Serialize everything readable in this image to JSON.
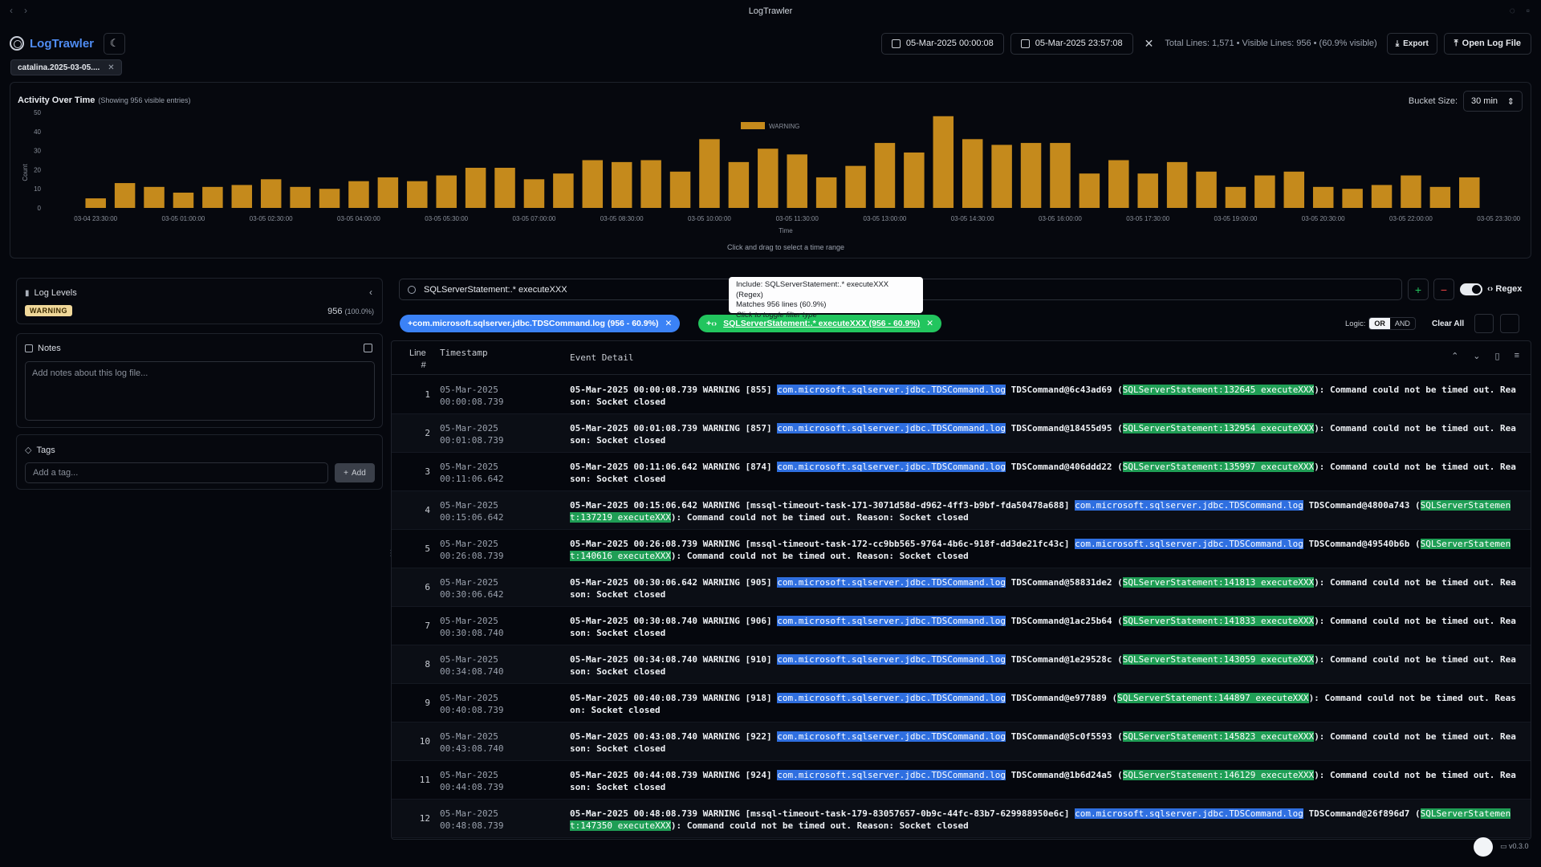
{
  "window": {
    "title": "LogTrawler"
  },
  "header": {
    "app_name": "LogTrawler",
    "start_time": "05-Mar-2025 00:00:08",
    "end_time": "05-Mar-2025 23:57:08",
    "stats": "Total Lines: 1,571  •  Visible Lines: 956  •  (60.9% visible)",
    "export_label": "Export",
    "open_label": "Open Log File"
  },
  "file_tab": {
    "label": "catalina.2025-03-05...."
  },
  "chart_panel": {
    "title": "Activity Over Time",
    "subtitle": "(Showing 956 visible entries)",
    "bucket_label": "Bucket Size:",
    "bucket_value": "30 min",
    "hint": "Click and drag to select a time range"
  },
  "chart_data": {
    "type": "bar",
    "title": "",
    "xlabel": "Time",
    "ylabel": "Count",
    "ylim": [
      0,
      50
    ],
    "yticks": [
      0,
      10,
      20,
      30,
      40,
      50
    ],
    "legend": "top-center",
    "series": [
      {
        "name": "WARNING",
        "color": "#c58a1c",
        "values": [
          5,
          13,
          11,
          8,
          11,
          12,
          15,
          11,
          10,
          14,
          16,
          14,
          17,
          21,
          21,
          15,
          18,
          25,
          24,
          25,
          19,
          36,
          24,
          31,
          28,
          16,
          22,
          34,
          29,
          48,
          36,
          33,
          34,
          34,
          18,
          25,
          18,
          24,
          19,
          11,
          17,
          19,
          11,
          10,
          12,
          17,
          11,
          16
        ]
      }
    ],
    "x_tick_labels": [
      "03-04 23:30:00",
      "03-05 01:00:00",
      "03-05 02:30:00",
      "03-05 04:00:00",
      "03-05 05:30:00",
      "03-05 07:00:00",
      "03-05 08:30:00",
      "03-05 10:00:00",
      "03-05 11:30:00",
      "03-05 13:00:00",
      "03-05 14:30:00",
      "03-05 16:00:00",
      "03-05 17:30:00",
      "03-05 19:00:00",
      "03-05 20:30:00",
      "03-05 22:00:00",
      "03-05 23:30:00"
    ]
  },
  "log_levels": {
    "title": "Log Levels",
    "level": "WARNING",
    "count": "956",
    "pct": "(100.0%)"
  },
  "notes": {
    "title": "Notes",
    "placeholder": "Add notes about this log file..."
  },
  "tags": {
    "title": "Tags",
    "placeholder": "Add a tag...",
    "add_label": "Add"
  },
  "search": {
    "value": "SQLServerStatement:.* executeXXX",
    "regex_label": "Regex"
  },
  "tooltip": {
    "line1": "Include: SQLServerStatement:.* executeXXX (Regex)",
    "line2": "Matches 956 lines (60.9%)",
    "line3": "Click to toggle filter type"
  },
  "filters": {
    "chip1": "+com.microsoft.sqlserver.jdbc.TDSCommand.log  (956 - 60.9%)",
    "chip2_prefix": "+‹›",
    "chip2": "SQLServerStatement:.* executeXXX  (956 - 60.9%)",
    "logic_label": "Logic:",
    "logic_or": "OR",
    "logic_and": "AND",
    "clear_all": "Clear All"
  },
  "table": {
    "col_line": "Line",
    "col_line2": "#",
    "col_ts": "Timestamp",
    "col_event": "Event Detail",
    "rows": [
      {
        "ln": "1",
        "d": "05-Mar-2025",
        "t": "00:00:08.739",
        "pre": "05-Mar-2025 00:00:08.739 WARNING [855] ",
        "cls": "com.microsoft.sqlserver.jdbc.TDSCommand.log",
        "mid": " TDSCommand@6c43ad69 (",
        "stmt": "SQLServerStatement:132645 executeXXX",
        "post": "): Command could not be timed out. Reason: Socket closed"
      },
      {
        "ln": "2",
        "d": "05-Mar-2025",
        "t": "00:01:08.739",
        "pre": "05-Mar-2025 00:01:08.739 WARNING [857] ",
        "cls": "com.microsoft.sqlserver.jdbc.TDSCommand.log",
        "mid": " TDSCommand@18455d95 (",
        "stmt": "SQLServerStatement:132954 executeXXX",
        "post": "): Command could not be timed out. Reason: Socket closed"
      },
      {
        "ln": "3",
        "d": "05-Mar-2025",
        "t": "00:11:06.642",
        "pre": "05-Mar-2025 00:11:06.642 WARNING [874] ",
        "cls": "com.microsoft.sqlserver.jdbc.TDSCommand.log",
        "mid": " TDSCommand@406ddd22 (",
        "stmt": "SQLServerStatement:135997 executeXXX",
        "post": "): Command could not be timed out. Reason: Socket closed"
      },
      {
        "ln": "4",
        "d": "05-Mar-2025",
        "t": "00:15:06.642",
        "pre": "05-Mar-2025 00:15:06.642 WARNING [mssql-timeout-task-171-3071d58d-d962-4ff3-b9bf-fda50478a688] ",
        "cls": "com.microsoft.sqlserver.jdbc.TDSCommand.log",
        "mid": " TDSCommand@4800a743 (",
        "stmt": "SQLServerStatement:137219 executeXXX",
        "post": "): Command could not be timed out. Reason: Socket closed"
      },
      {
        "ln": "5",
        "d": "05-Mar-2025",
        "t": "00:26:08.739",
        "pre": "05-Mar-2025 00:26:08.739 WARNING [mssql-timeout-task-172-cc9bb565-9764-4b6c-918f-dd3de21fc43c] ",
        "cls": "com.microsoft.sqlserver.jdbc.TDSCommand.log",
        "mid": " TDSCommand@49540b6b (",
        "stmt": "SQLServerStatement:140616 executeXXX",
        "post": "): Command could not be timed out. Reason: Socket closed"
      },
      {
        "ln": "6",
        "d": "05-Mar-2025",
        "t": "00:30:06.642",
        "pre": "05-Mar-2025 00:30:06.642 WARNING [905] ",
        "cls": "com.microsoft.sqlserver.jdbc.TDSCommand.log",
        "mid": " TDSCommand@58831de2 (",
        "stmt": "SQLServerStatement:141813 executeXXX",
        "post": "): Command could not be timed out. Reason: Socket closed"
      },
      {
        "ln": "7",
        "d": "05-Mar-2025",
        "t": "00:30:08.740",
        "pre": "05-Mar-2025 00:30:08.740 WARNING [906] ",
        "cls": "com.microsoft.sqlserver.jdbc.TDSCommand.log",
        "mid": " TDSCommand@1ac25b64 (",
        "stmt": "SQLServerStatement:141833 executeXXX",
        "post": "): Command could not be timed out. Reason: Socket closed"
      },
      {
        "ln": "8",
        "d": "05-Mar-2025",
        "t": "00:34:08.740",
        "pre": "05-Mar-2025 00:34:08.740 WARNING [910] ",
        "cls": "com.microsoft.sqlserver.jdbc.TDSCommand.log",
        "mid": " TDSCommand@1e29528c (",
        "stmt": "SQLServerStatement:143059 executeXXX",
        "post": "): Command could not be timed out. Reason: Socket closed"
      },
      {
        "ln": "9",
        "d": "05-Mar-2025",
        "t": "00:40:08.739",
        "pre": "05-Mar-2025 00:40:08.739 WARNING [918] ",
        "cls": "com.microsoft.sqlserver.jdbc.TDSCommand.log",
        "mid": " TDSCommand@e977889 (",
        "stmt": "SQLServerStatement:144897 executeXXX",
        "post": "): Command could not be timed out. Reason: Socket closed"
      },
      {
        "ln": "10",
        "d": "05-Mar-2025",
        "t": "00:43:08.740",
        "pre": "05-Mar-2025 00:43:08.740 WARNING [922] ",
        "cls": "com.microsoft.sqlserver.jdbc.TDSCommand.log",
        "mid": " TDSCommand@5c0f5593 (",
        "stmt": "SQLServerStatement:145823 executeXXX",
        "post": "): Command could not be timed out. Reason: Socket closed"
      },
      {
        "ln": "11",
        "d": "05-Mar-2025",
        "t": "00:44:08.739",
        "pre": "05-Mar-2025 00:44:08.739 WARNING [924] ",
        "cls": "com.microsoft.sqlserver.jdbc.TDSCommand.log",
        "mid": " TDSCommand@1b6d24a5 (",
        "stmt": "SQLServerStatement:146129 executeXXX",
        "post": "): Command could not be timed out. Reason: Socket closed"
      },
      {
        "ln": "12",
        "d": "05-Mar-2025",
        "t": "00:48:08.739",
        "pre": "05-Mar-2025 00:48:08.739 WARNING [mssql-timeout-task-179-83057657-0b9c-44fc-83b7-629988950e6c] ",
        "cls": "com.microsoft.sqlserver.jdbc.TDSCommand.log",
        "mid": " TDSCommand@26f896d7 (",
        "stmt": "SQLServerStatement:147350 executeXXX",
        "post": "): Command could not be timed out. Reason: Socket closed"
      }
    ]
  },
  "footer": {
    "version": "v0.3.0"
  }
}
